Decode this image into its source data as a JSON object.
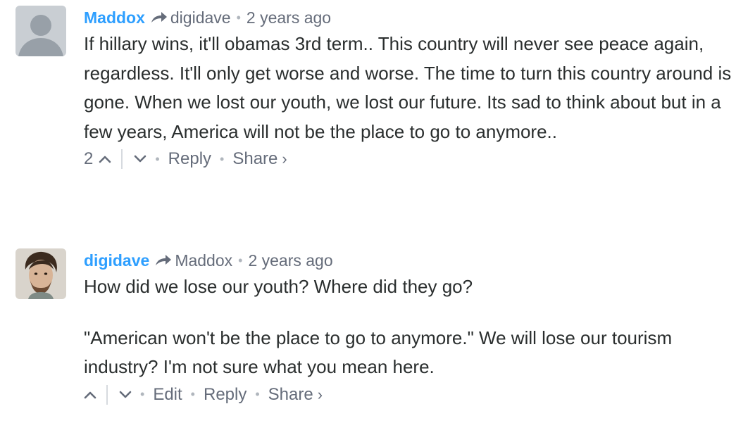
{
  "comments": [
    {
      "author": "Maddox",
      "reply_to": "digidave",
      "time": "2 years ago",
      "paragraphs": [
        "If hillary wins, it'll obamas 3rd term.. This country will never see peace again, regardless. It'll only get worse and worse. The time to turn this country around is gone. When we lost our youth, we lost our future. Its sad to think about but in a few years, America will not be the place to go to anymore.."
      ],
      "upvotes": "2",
      "actions": {
        "reply": "Reply",
        "share": "Share"
      }
    },
    {
      "author": "digidave",
      "reply_to": "Maddox",
      "time": "2 years ago",
      "paragraphs": [
        "How did we lose our youth? Where did they go?",
        "\"American won't be the place to go to anymore.\" We will lose our tourism industry? I'm not sure what you mean here."
      ],
      "actions": {
        "edit": "Edit",
        "reply": "Reply",
        "share": "Share"
      }
    }
  ],
  "icons": {
    "reply_arrow": "reply-arrow-icon",
    "upvote": "chevron-up-icon",
    "downvote": "chevron-down-icon",
    "share_chevron": "›"
  },
  "colors": {
    "author": "#2e9fff",
    "meta": "#656c7a",
    "text": "#2a2e2e"
  }
}
